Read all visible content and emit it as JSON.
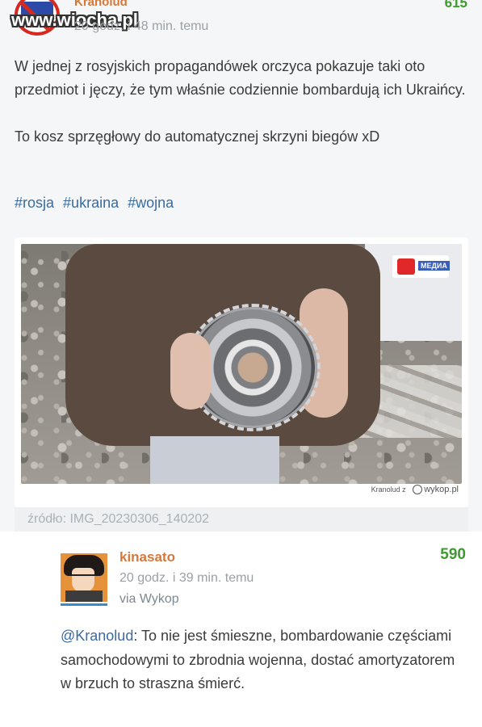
{
  "watermark": {
    "text": "www.wiocha.pl"
  },
  "post": {
    "author": "Kranolud",
    "time": "20 godz. i 48 min. temu",
    "votes": "615",
    "paragraphs": [
      "W jednej z rosyjskich propagandówek orczyca pokazuje taki oto przedmiot i jęczy, że tym właśnie codziennie bombardują ich Ukraińcy.",
      "To kosz sprzęgłowy do automatycznej skrzyni biegów xD"
    ],
    "tags": [
      "#rosja",
      "#ukraina",
      "#wojna"
    ],
    "image": {
      "badge_text": "МЕДИА",
      "credit_author": "Kranolud z",
      "credit_site": "wykop.pl"
    },
    "source": "źródło: IMG_20230306_140202"
  },
  "reply": {
    "author": "kinasato",
    "votes": "590",
    "time": "20 godz. i 39 min. temu",
    "via": "via Wykop",
    "mention": "@Kranolud",
    "text": ": To nie jest śmieszne, bombardowanie częściami samochodowymi to zbrodnia wojenna, dostać amortyzatorem w brzuch to straszna śmierć."
  },
  "colors": {
    "author": "#d4783b",
    "votes": "#3c9a2e",
    "link": "#3a6ba0",
    "muted": "#9aa0a6"
  }
}
